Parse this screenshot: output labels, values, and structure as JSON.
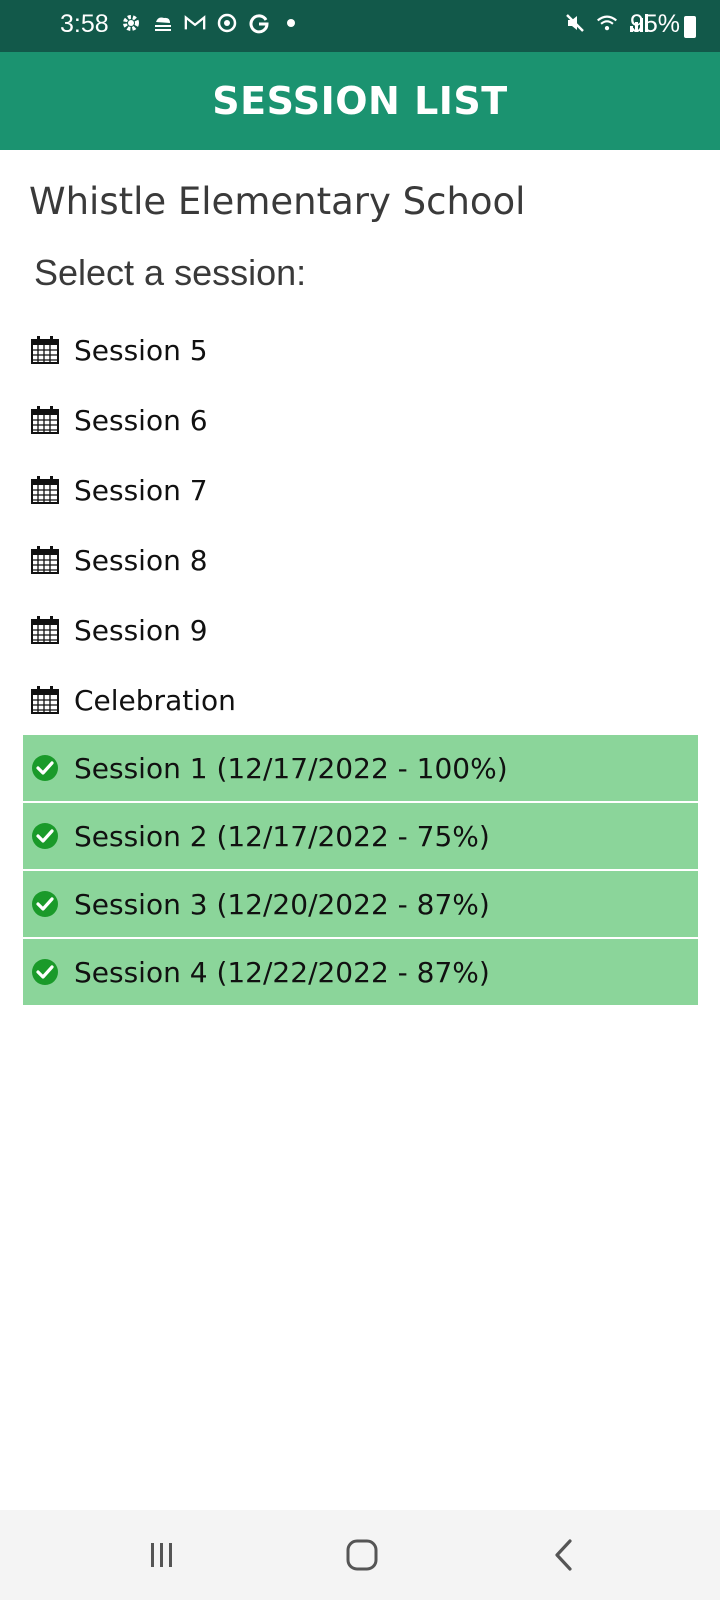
{
  "status_bar": {
    "time": "3:58",
    "battery": "95%",
    "left_icons": [
      "settings-icon",
      "weather-icon",
      "gmail-icon",
      "sync-icon",
      "google-icon",
      "dot-icon"
    ],
    "right_icons": [
      "mute-icon",
      "wifi-icon",
      "signal-icon"
    ]
  },
  "header": {
    "title": "SESSION LIST"
  },
  "school_name": "Whistle Elementary School",
  "prompt": "Select a session:",
  "sessions": [
    {
      "label": "Session 5"
    },
    {
      "label": "Session 6"
    },
    {
      "label": "Session 7"
    },
    {
      "label": "Session 8"
    },
    {
      "label": "Session 9"
    },
    {
      "label": "Celebration"
    }
  ],
  "completed_sessions": [
    {
      "label": "Session 1 (12/17/2022 - 100%)"
    },
    {
      "label": "Session 2 (12/17/2022 - 75%)"
    },
    {
      "label": "Session 3 (12/20/2022 - 87%)"
    },
    {
      "label": "Session 4 (12/22/2022 - 87%)"
    }
  ],
  "colors": {
    "status_bar": "#12594a",
    "app_bar": "#1b9370",
    "completed_bg": "#8bd59a",
    "check": "#1a9a2a"
  },
  "nav_bar": [
    "recents-icon",
    "home-icon",
    "back-icon"
  ]
}
